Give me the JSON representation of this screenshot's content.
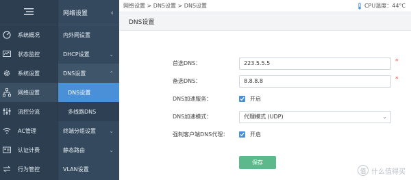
{
  "sidebar": {
    "menu_icon": "menu-icon",
    "items": [
      {
        "label": "系统概况",
        "icon": "dashboard-icon"
      },
      {
        "label": "状态监控",
        "icon": "monitor-icon"
      },
      {
        "label": "系统设置",
        "icon": "gear-icon"
      },
      {
        "label": "网络设置",
        "icon": "network-icon",
        "active": true
      },
      {
        "label": "流控分流",
        "icon": "sliders-icon"
      },
      {
        "label": "AC管理",
        "icon": "wifi-icon"
      },
      {
        "label": "认证计费",
        "icon": "id-card-icon"
      },
      {
        "label": "行为管控",
        "icon": "arrows-icon"
      }
    ]
  },
  "subnav": {
    "title": "网络设置",
    "collapse_icon": "chevron-left-icon",
    "items": [
      {
        "label": "内外网设置"
      },
      {
        "label": "DHCP设置",
        "icon": "chevron-down-icon"
      },
      {
        "label": "DNS设置",
        "icon": "chevron-up-icon",
        "open": true
      },
      {
        "label": "DNS设置",
        "sub": true,
        "selected": true
      },
      {
        "label": "多线路DNS",
        "sub": true
      },
      {
        "label": "终端分组设置",
        "icon": "chevron-down-icon"
      },
      {
        "label": "静态路由",
        "icon": "chevron-down-icon"
      },
      {
        "label": "VLAN设置"
      }
    ]
  },
  "topbar": {
    "breadcrumb": "网络设置 > DNS设置 > DNS设置",
    "cpu_temp": "CPU温度：44°C"
  },
  "section": {
    "title": "DNS设置"
  },
  "form": {
    "primary_dns": {
      "label": "首选DNS：",
      "value": "223.5.5.5",
      "required": "*"
    },
    "secondary_dns": {
      "label": "备选DNS：",
      "value": "8.8.8.8",
      "required": "*"
    },
    "dns_accel": {
      "label": "DNS加速服务：",
      "checked": true,
      "text": "开启"
    },
    "dns_mode": {
      "label": "DNS加速模式：",
      "value": "代理模式 (UDP)"
    },
    "force_proxy": {
      "label": "强制客户端DNS代理：",
      "checked": true,
      "text": "开启"
    },
    "save_label": "保存"
  },
  "watermark": {
    "text": "什么值得买",
    "logo": "值"
  },
  "colors": {
    "sidebar_bg": "#2c3e50",
    "subnav_bg": "#34495e",
    "selected": "#4a90d9",
    "save_button": "#5cb98c",
    "required": "#e74c3c"
  }
}
